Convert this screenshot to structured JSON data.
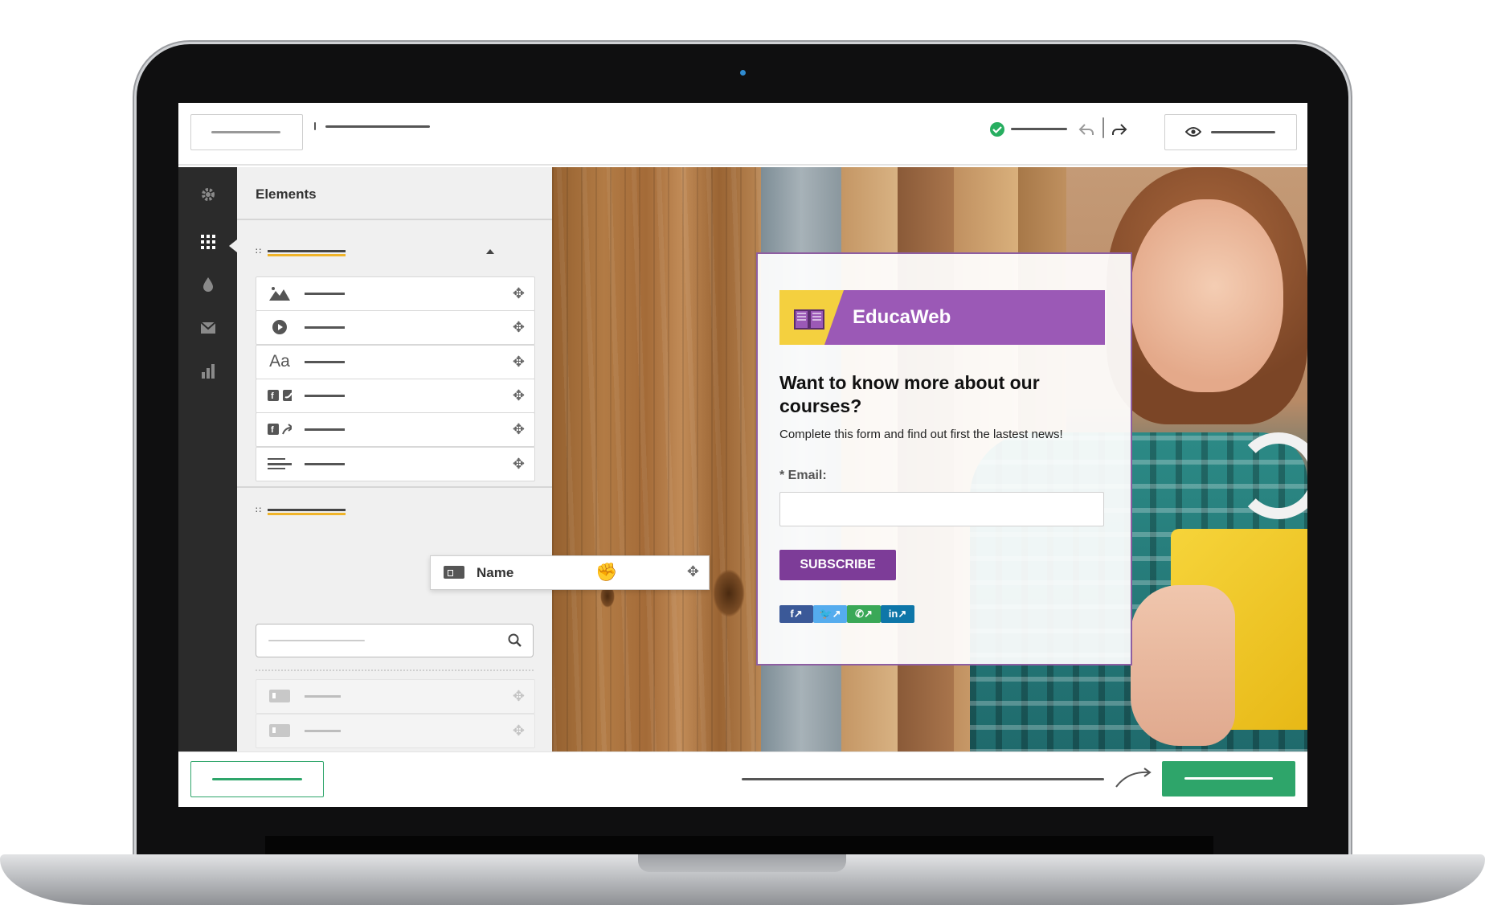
{
  "panel": {
    "title": "Elements",
    "drag_item": {
      "label": "Name"
    }
  },
  "form": {
    "brand": "EducaWeb",
    "headline": "Want to know more about our courses?",
    "subtitle": "Complete this form and find out first the lastest news!",
    "email_label": "* Email:",
    "email_placeholder": "",
    "button": "SUBSCRIBE",
    "social": [
      {
        "label": "f↗",
        "color": "#3b5998"
      },
      {
        "label": "🐦↗",
        "color": "#55acee"
      },
      {
        "label": "✆↗",
        "color": "#3aa857"
      },
      {
        "label": "in↗",
        "color": "#0e76a8"
      }
    ]
  },
  "icons": {
    "rail": [
      "gear-icon",
      "grid-icon",
      "drop-icon",
      "mail-icon",
      "chart-icon"
    ],
    "elements": [
      "image-icon",
      "play-icon",
      "text-icon",
      "social-follow-icon",
      "social-share-icon",
      "divider-icon"
    ]
  },
  "colors": {
    "accent": "#f0b429",
    "brand_purple": "#9b59b6",
    "button_purple": "#7d3c98",
    "publish_green": "#2ea56a",
    "check_green": "#27ae60"
  },
  "placeholder_lines": {
    "file_button": "",
    "title": "",
    "status": "",
    "preview": "",
    "back_button": "",
    "hint": "",
    "next_button": ""
  }
}
